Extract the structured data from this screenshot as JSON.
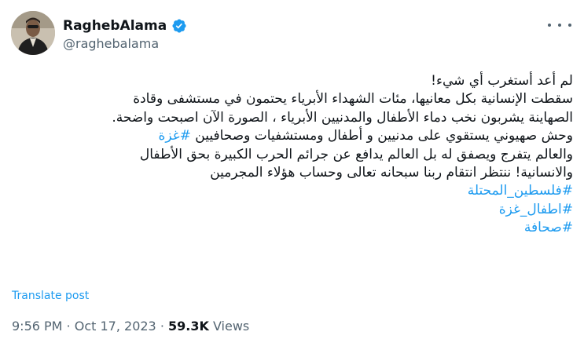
{
  "author": {
    "display_name": "RaghebAlama",
    "handle": "@raghebalama",
    "verified_icon": "verified-badge-icon",
    "accent": "#1d9bf0"
  },
  "tweet": {
    "lines": [
      "لم أعد أستغرب أي شيء!",
      "سقطت الإنسانية بكل معانيها، مئات الشهداء الأبرياء يحتمون في مستشفى وقادة",
      "الصهاينة يشربون نخب دماء الأطفال والمدنيين الأبرياء ، الصورة الآن اصبحت واضحة.",
      "وحش صهيوني يستقوي على مدنيين و أطفال ومستشفيات وصحافيين",
      "والعالم يتفرج ويصفق له بل العالم يدافع عن جرائم الحرب الكبيرة بحق الأطفال",
      "والانسانية! ننتظر انتقام ربنا سبحانه تعالى وحساب هؤلاء المجرمين"
    ],
    "inline_hashtag": "#غزة",
    "hashtags": [
      "#فلسطين_المحتلة",
      "#اطفال_غزة",
      "#صحافة"
    ]
  },
  "translate_label": "Translate post",
  "timestamp": {
    "time": "9:56 PM",
    "separator": " · ",
    "date": "Oct 17, 2023",
    "views_count": "59.3K",
    "views_label": " Views"
  }
}
